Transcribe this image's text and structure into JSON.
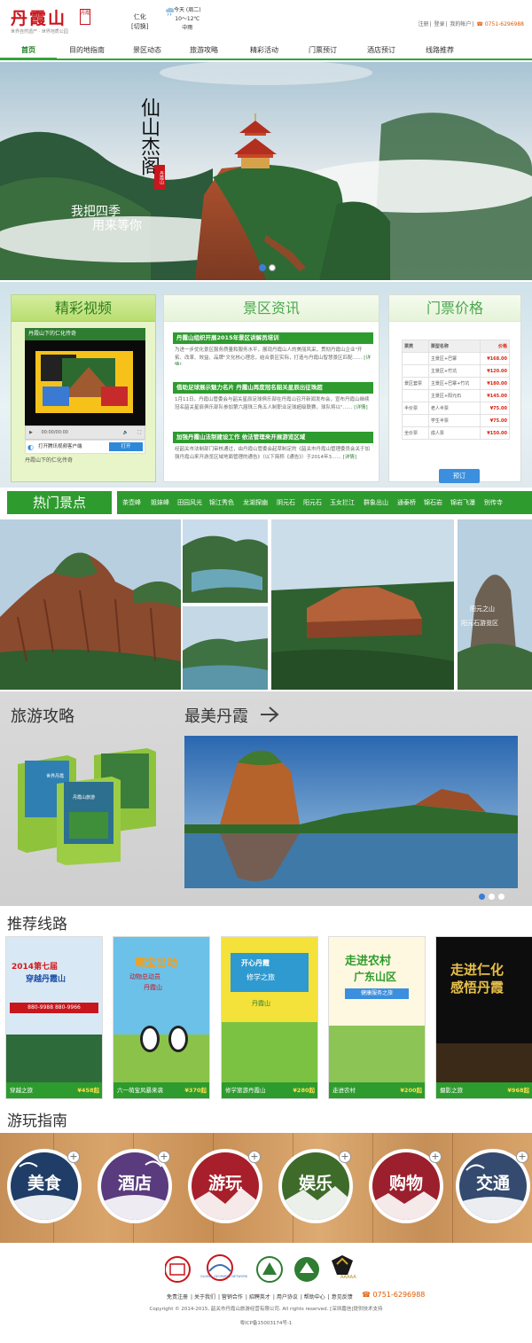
{
  "header": {
    "logo_text": "丹霞山",
    "logo_sub": "世界自然遗产 · 世界地质公园",
    "logo_seal": "丹霞",
    "region_name": "仁化",
    "region_note": "[切换]",
    "weather_day": "今天 (周二)",
    "weather_temp": "10～12℃",
    "weather_desc": "中雨",
    "links": [
      "注册",
      "登录",
      "我的帐户"
    ],
    "phone": "0751-6296988"
  },
  "nav": [
    "首页",
    "目的地指南",
    "景区动态",
    "旅游攻略",
    "精彩活动",
    "门票预订",
    "酒店预订",
    "线路推荐"
  ],
  "banner": {
    "calligraphy": "仙山杰阁",
    "slogan_1": "我把四季",
    "slogan_2": "用来等你",
    "seal": "丹霞山"
  },
  "video": {
    "title": "精彩视频",
    "header": "丹霞山下的仁化传奇",
    "time": "00:00/00:00",
    "open_text": "打开腾讯视频客户端",
    "open_btn": "打开",
    "caption": "丹霞山下的仁化传奇"
  },
  "news": {
    "title": "景区资讯",
    "items": [
      {
        "head": "丹霞山组织开展2015年景区讲解员培训",
        "body": "为进一步优化景区服务质量和服务水平，展现丹霞山人的美丽风采，贯彻丹霞山企业\"开拓、改革、效益、品牌\"文化核心理念，结合景区实际，打造与丹霞山智慧景区匹配……",
        "more": "[详情]"
      },
      {
        "head": "借助足球展示魅力名片 丹霞山再度冠名韶关星辰出征珠超",
        "body": "1月11日，丹霞山管委会与韶关星辰足球俱乐部在丹霞山召开新闻发布会，宣布丹霞山继续冠名韶关星辰俱乐部队参加第六届珠三角五人制职业足球超级联赛，球队将以\"……",
        "more": "[详情]"
      },
      {
        "head": "加强丹霞山法制建设工作 依法管理来开展游览区域",
        "body": "经韶关市法制部门审核通过，由丹霞山管委会起草制定的《韶关市丹霞山管理委员会关于加强丹霞山来开游览区域地面管理的通告》（以下简称《通告》）于2014年3……",
        "more": "[详情]"
      }
    ]
  },
  "tickets": {
    "title": "门票价格",
    "headers": [
      "票类",
      "票型名称",
      "价格"
    ],
    "rows": [
      [
        "",
        "主景区+巴寨",
        "¥168.00"
      ],
      [
        "",
        "主景区+竹坑",
        "¥120.00"
      ],
      [
        "景区套票",
        "主景区+巴寨+竹坑",
        "¥180.00"
      ],
      [
        "",
        "主景区+阳元石",
        "¥145.00"
      ],
      [
        "半价票",
        "老人半票",
        "¥75.00"
      ],
      [
        "",
        "学生半票",
        "¥75.00"
      ],
      [
        "全价票",
        "成人票",
        "¥150.00"
      ]
    ],
    "book_btn": "预订"
  },
  "hot": {
    "title": "热门景点",
    "tags": [
      "茶壶峰",
      "姐妹峰",
      "田园风光",
      "锦江秀色",
      "龙湖探幽",
      "阴元石",
      "阳元石",
      "玉女拦江",
      "群象出山",
      "通泰桥",
      "锦石岩",
      "锦岩飞瀑",
      "别传寺"
    ],
    "gallery_caption_1": "阳元之山",
    "gallery_caption_2": "阳元石游览区"
  },
  "travel": {
    "title": "旅游攻略",
    "beauty_title": "最美丹霞",
    "book_label": "丹霞山旅游",
    "book_label_2": "世界丹霞"
  },
  "routes": {
    "title": "推荐线路",
    "items": [
      {
        "name": "穿越之旅",
        "price": "¥458起",
        "poster_1": "2014第七届",
        "poster_2": "穿越丹霞山",
        "poster_3": "880-9988 880-9966"
      },
      {
        "name": "六一萌宝风暴来袭",
        "price": "¥370起",
        "poster_1": "萌宝出动",
        "poster_2": "动物总动员",
        "poster_3": "丹霞山"
      },
      {
        "name": "修学旅游丹霞山",
        "price": "¥280起",
        "poster_1": "开心丹霞",
        "poster_2": "修学之旅",
        "poster_3": "丹霞山"
      },
      {
        "name": "走进农村",
        "price": "¥200起",
        "poster_1": "走进农村",
        "poster_2": "广东山区",
        "poster_3": "健康服务之旅"
      },
      {
        "name": "摄影之旅",
        "price": "¥968起",
        "poster_1": "走进仁化",
        "poster_2": "感悟丹霞",
        "poster_3": ""
      }
    ]
  },
  "guide": {
    "title": "游玩指南",
    "items": [
      {
        "label": "美食",
        "color": "#1f3d66"
      },
      {
        "label": "酒店",
        "color": "#5a3b7d"
      },
      {
        "label": "游玩",
        "color": "#a71f2a"
      },
      {
        "label": "娱乐",
        "color": "#3e6b2a"
      },
      {
        "label": "购物",
        "color": "#9b1f2d"
      },
      {
        "label": "交通",
        "color": "#344a6e"
      }
    ]
  },
  "footer": {
    "links": [
      "免责注册",
      "关于我们",
      "营销合作",
      "招聘英才",
      "用户协议",
      "帮助中心",
      "意见反馈"
    ],
    "phone": "0751-6296988",
    "copyright": "Copyright © 2014-2015, 韶关市丹霞山旅游经营有限公司. All rights reserved. [深圳嘉信]提供技术支持",
    "icp": "粤ICP备15003174号-1",
    "logo_texts": [
      "GLOBAL GEOPARKS NETWORK",
      "AAAAA"
    ]
  },
  "colors": {
    "brand_green": "#2e9b2e",
    "brand_red": "#c8161d",
    "price_red": "#d9230f",
    "accent_blue": "#3b8fde"
  }
}
